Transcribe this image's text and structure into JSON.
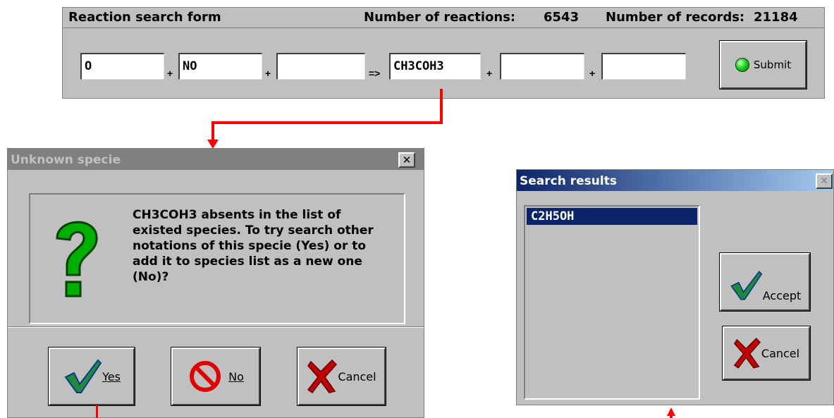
{
  "search_form": {
    "title": "Reaction search form",
    "reactions_label": "Number of reactions:",
    "reactions_count": "6543",
    "records_label": "Number of records:",
    "records_count": "21184",
    "fields": [
      "O",
      "NO",
      "",
      "CH3COH3",
      "",
      ""
    ],
    "plus": "+",
    "arrow": "=>",
    "submit_label": "Submit",
    "indicator_color": "#00c000"
  },
  "unknown_dialog": {
    "title": "Unknown specie",
    "close": "✕",
    "message": "CH3COH3 absents in the list of existed species. To try search other notations of this specie (Yes) or to add it to species list as a new one (No)?",
    "yes_label": "Yes",
    "no_label": "No",
    "cancel_label": "Cancel",
    "icon": "question-icon"
  },
  "results_dialog": {
    "title": "Search results",
    "close": "✕",
    "items": [
      "C2H5OH"
    ],
    "accept_label": "Accept",
    "cancel_label": "Cancel"
  },
  "colors": {
    "accent": "#0a246a",
    "arrow": "#ff0000",
    "face": "#c0c0c0"
  }
}
